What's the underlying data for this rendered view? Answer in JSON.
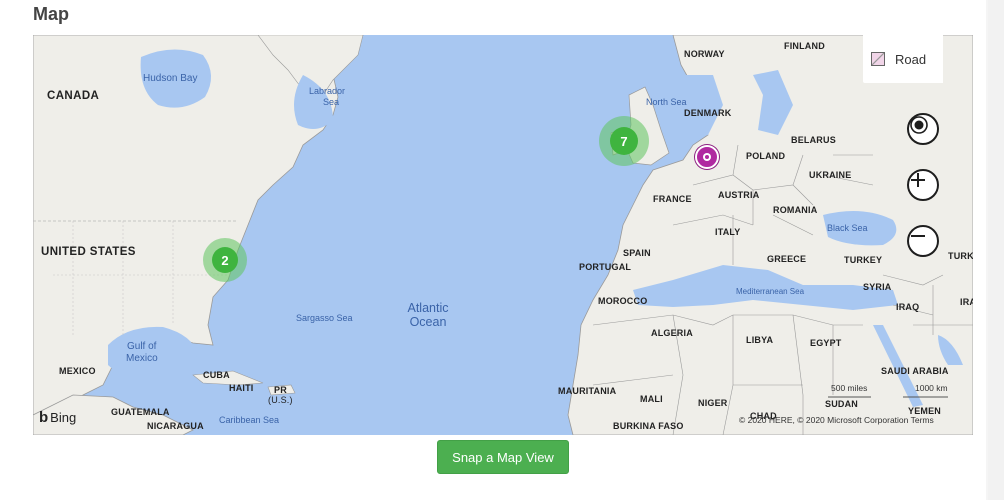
{
  "page": {
    "title": "Map"
  },
  "map": {
    "style_button": {
      "label": "Road",
      "icon": "road-map-icon"
    },
    "controls": {
      "locate_icon": "locate-me-icon",
      "zoom_in_icon": "zoom-in-icon",
      "zoom_out_icon": "zoom-out-icon"
    },
    "logo": {
      "brand": "Bing"
    },
    "attribution": {
      "text": "© 2020 HERE, © 2020 Microsoft Corporation",
      "terms": "Terms"
    },
    "scale": {
      "imperial": "500 miles",
      "metric": "1000 km"
    },
    "clusters": [
      {
        "count": "2",
        "color": "#3fb43f"
      },
      {
        "count": "7",
        "color": "#3fb43f"
      }
    ],
    "pin": {
      "color": "#b02aa0"
    },
    "labels": {
      "canada": "CANADA",
      "united_states": "UNITED STATES",
      "mexico": "MEXICO",
      "cuba": "CUBA",
      "haiti": "HAITI",
      "pr": "PR",
      "pr_sub": "(U.S.)",
      "guatemala": "GUATEMALA",
      "nicaragua": "NICARAGUA",
      "hudson_bay": "Hudson Bay",
      "labrador_sea_1": "Labrador",
      "labrador_sea_2": "Sea",
      "gulf_mexico_1": "Gulf of",
      "gulf_mexico_2": "Mexico",
      "sargasso": "Sargasso Sea",
      "caribbean": "Caribbean Sea",
      "atlantic_1": "Atlantic",
      "atlantic_2": "Ocean",
      "norway": "NORWAY",
      "finland": "FINLAND",
      "north_sea": "North Sea",
      "denmark": "DENMARK",
      "belarus": "BELARUS",
      "poland": "POLAND",
      "ukraine": "UKRAINE",
      "france": "FRANCE",
      "austria": "AUSTRIA",
      "romania": "ROMANIA",
      "italy": "ITALY",
      "black_sea": "Black Sea",
      "spain": "SPAIN",
      "portugal": "PORTUGAL",
      "greece": "GREECE",
      "turkey": "TURKEY",
      "turkmen": "TURKI",
      "syria": "SYRIA",
      "iraq": "IRAQ",
      "ira": "IRA",
      "morocco": "MOROCCO",
      "algeria": "ALGERIA",
      "libya": "LIBYA",
      "egypt": "EGYPT",
      "mediterranean": "Mediterranean Sea",
      "saudi": "SAUDI ARABIA",
      "mauritania": "MAURITANIA",
      "mali": "MALI",
      "niger": "NIGER",
      "chad": "CHAD",
      "sudan": "SUDAN",
      "yemen": "YEMEN",
      "burkina": "BURKINA FASO"
    }
  },
  "actions": {
    "snap_label": "Snap a Map View"
  }
}
